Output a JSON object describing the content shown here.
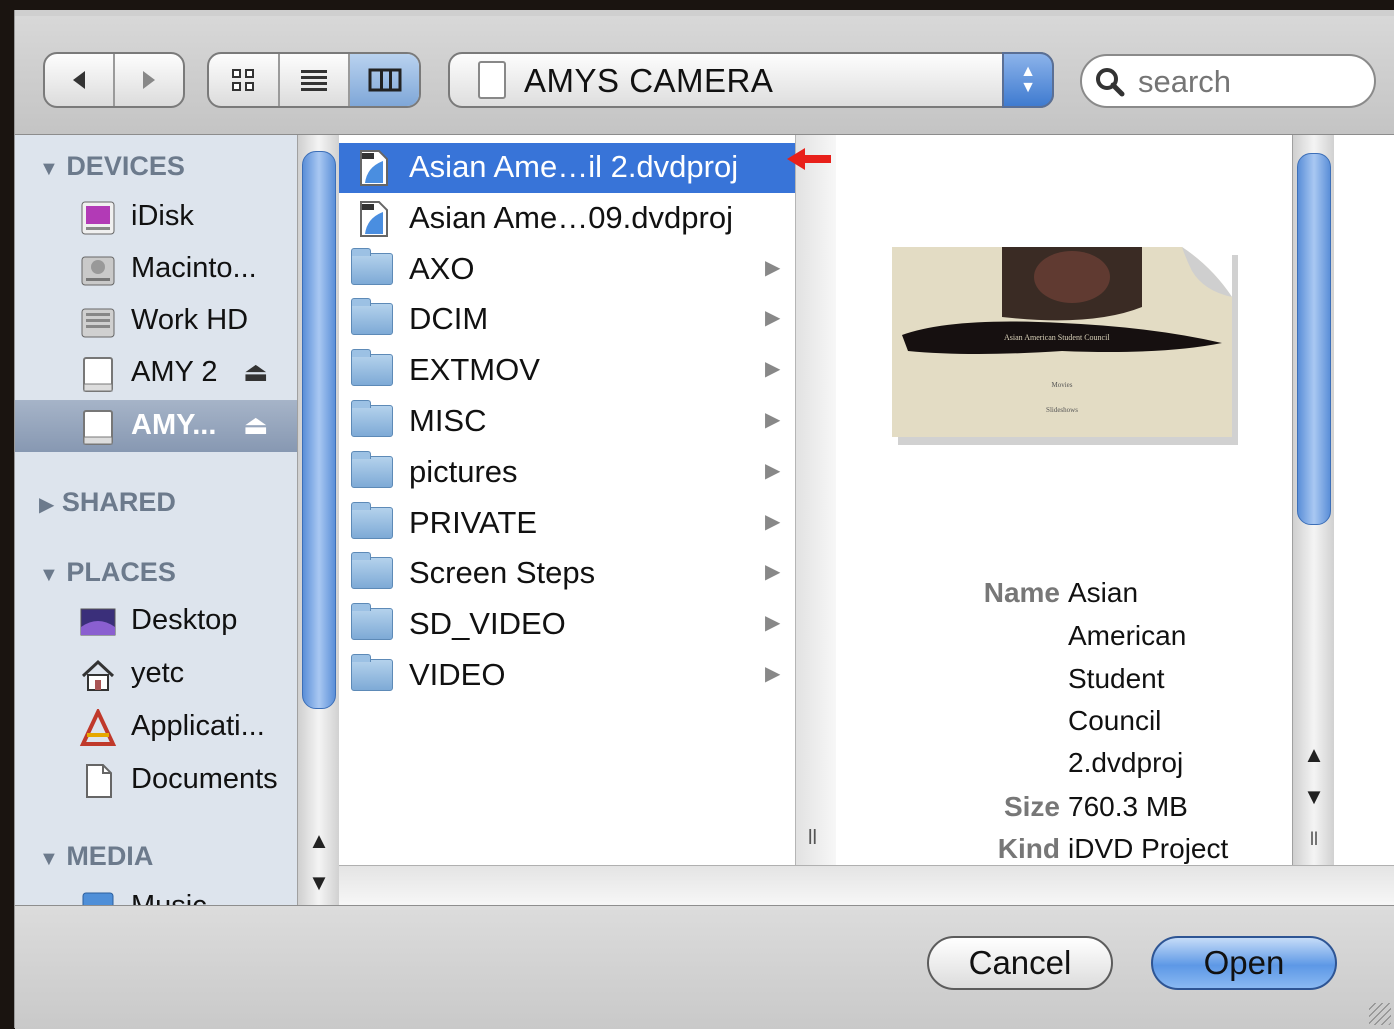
{
  "toolbar": {
    "back_icon": "back-arrow-icon",
    "forward_icon": "forward-arrow-icon",
    "view_modes": [
      "icon-view",
      "list-view",
      "column-view"
    ],
    "active_view": "column-view",
    "location": "AMYS CAMERA",
    "search_placeholder": "search"
  },
  "sidebar": {
    "devices_header": "DEVICES",
    "devices": [
      {
        "label": "iDisk",
        "icon": "idisk-icon"
      },
      {
        "label": "Macinto...",
        "icon": "hard-disk-icon"
      },
      {
        "label": "Work HD",
        "icon": "hard-disk-icon"
      },
      {
        "label": "AMY 2",
        "icon": "removable-disk-icon",
        "eject": "⏏"
      },
      {
        "label": "AMY...",
        "icon": "removable-disk-icon",
        "eject": "⏏",
        "selected": true
      }
    ],
    "shared_header": "SHARED",
    "places_header": "PLACES",
    "places": [
      {
        "label": "Desktop",
        "icon": "desktop-icon"
      },
      {
        "label": "yetc",
        "icon": "home-icon"
      },
      {
        "label": "Applicati...",
        "icon": "applications-icon"
      },
      {
        "label": "Documents",
        "icon": "documents-icon"
      }
    ],
    "media_header": "MEDIA",
    "media": [
      {
        "label": "Music",
        "icon": "music-icon"
      }
    ]
  },
  "files": [
    {
      "name": "Asian Ame…il 2.dvdproj",
      "type": "dvdproj",
      "selected": true
    },
    {
      "name": "Asian Ame…09.dvdproj",
      "type": "dvdproj"
    },
    {
      "name": "AXO",
      "type": "folder"
    },
    {
      "name": "DCIM",
      "type": "folder"
    },
    {
      "name": "EXTMOV",
      "type": "folder"
    },
    {
      "name": "MISC",
      "type": "folder"
    },
    {
      "name": "pictures",
      "type": "folder"
    },
    {
      "name": "PRIVATE",
      "type": "folder"
    },
    {
      "name": "Screen Steps",
      "type": "folder"
    },
    {
      "name": "SD_VIDEO",
      "type": "folder"
    },
    {
      "name": "VIDEO",
      "type": "folder"
    }
  ],
  "preview": {
    "thumb_title": "Asian American Student Council",
    "thumb_menu": [
      "Movies",
      "Slideshows"
    ],
    "name_label": "Name",
    "name_lines": [
      "Asian",
      "American",
      "Student",
      "Council",
      "2.dvdproj"
    ],
    "size_label": "Size",
    "size_value": "760.3 MB",
    "kind_label": "Kind",
    "kind_value": "iDVD Project"
  },
  "buttons": {
    "cancel": "Cancel",
    "open": "Open"
  },
  "colors": {
    "selection": "#3874d8",
    "sidebar_bg": "#dde4ed",
    "sidebar_selected": "#8798b2",
    "annotation_arrow": "#e8201a"
  }
}
